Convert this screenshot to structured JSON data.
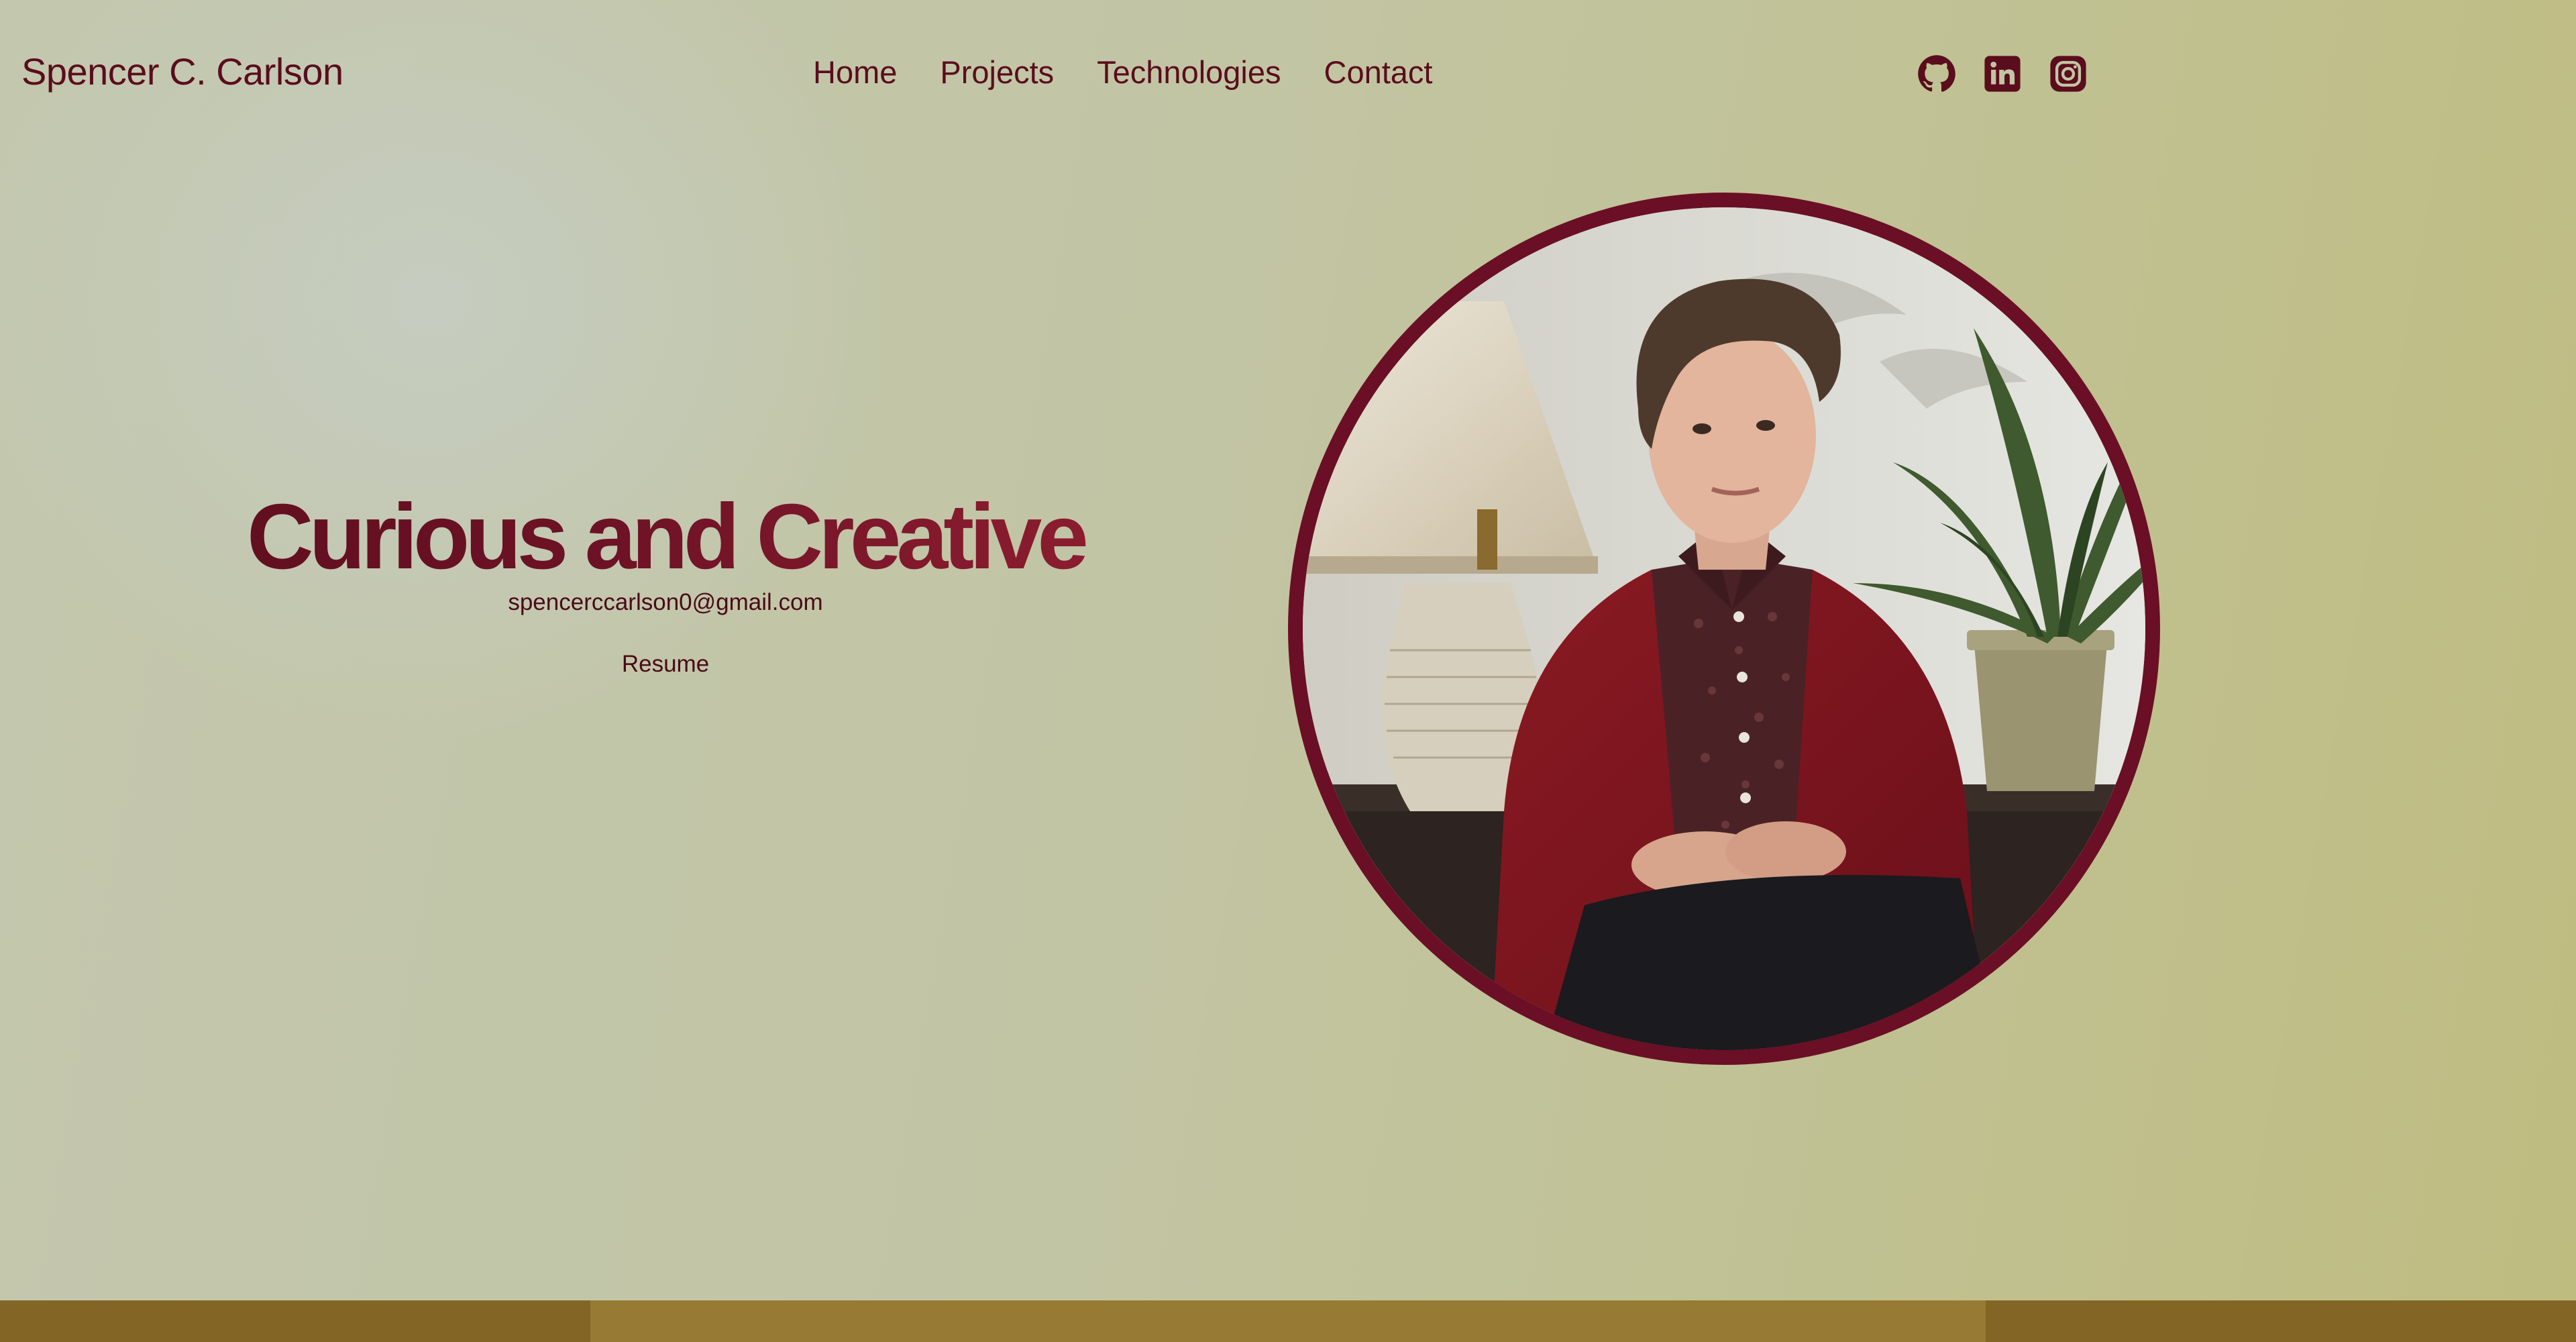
{
  "header": {
    "brand": "Spencer C. Carlson",
    "nav": [
      {
        "label": "Home"
      },
      {
        "label": "Projects"
      },
      {
        "label": "Technologies"
      },
      {
        "label": "Contact"
      }
    ],
    "socials": [
      {
        "icon": "github-icon"
      },
      {
        "icon": "linkedin-icon"
      },
      {
        "icon": "instagram-icon"
      }
    ]
  },
  "hero": {
    "title": "Curious and Creative",
    "email": "spencerccarlson0@gmail.com",
    "resume_label": "Resume"
  },
  "portrait": {
    "subject": "profile-photo"
  },
  "colors": {
    "accent": "#5a0d1c",
    "ring": "#6a0f25",
    "background": "#c2c5a4",
    "band": "#836525",
    "band_center": "#977a33"
  }
}
